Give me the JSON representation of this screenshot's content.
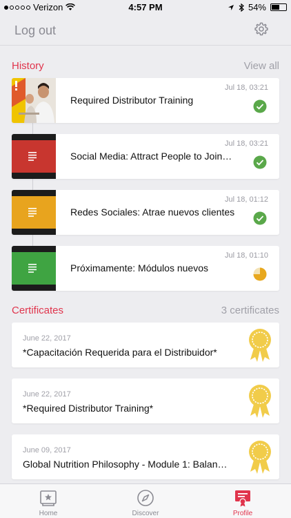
{
  "status_bar": {
    "carrier": "Verizon",
    "time": "4:57 PM",
    "battery": "54%",
    "battery_level": 0.54,
    "signal_dots_filled": 1,
    "signal_dots_total": 5
  },
  "header": {
    "logout_label": "Log out",
    "settings_icon": "gear-icon"
  },
  "history": {
    "title": "History",
    "view_all_label": "View all",
    "items": [
      {
        "title": "Required Distributor Training",
        "date": "Jul 18, 03:21",
        "status": "complete",
        "thumb": "photo",
        "thumb_color": "#f0c400"
      },
      {
        "title": "Social Media: Attract People to Join…",
        "date": "Jul 18, 03:21",
        "status": "complete",
        "thumb": "doc",
        "thumb_color": "#c8362f"
      },
      {
        "title": "Redes Sociales: Atrae nuevos clientes",
        "date": "Jul 18, 01:12",
        "status": "complete",
        "thumb": "doc",
        "thumb_color": "#e8a41e"
      },
      {
        "title": "Próximamente: Módulos nuevos",
        "date": "Jul 18, 01:10",
        "status": "in-progress",
        "thumb": "doc",
        "thumb_color": "#3fa442"
      }
    ]
  },
  "certificates": {
    "title": "Certificates",
    "count_label": "3 certificates",
    "items": [
      {
        "date": "June 22, 2017",
        "title": "*Capacitación Requerida para el Distribuidor*"
      },
      {
        "date": "June 22, 2017",
        "title": "*Required Distributor Training*"
      },
      {
        "date": "June 09, 2017",
        "title": "Global Nutrition Philosophy - Module 1: Balan…"
      }
    ]
  },
  "tabbar": {
    "tabs": [
      {
        "label": "Home",
        "icon": "star-card-icon",
        "active": false
      },
      {
        "label": "Discover",
        "icon": "compass-icon",
        "active": false
      },
      {
        "label": "Profile",
        "icon": "certificate-icon",
        "active": true
      }
    ]
  },
  "colors": {
    "accent": "#e0344c",
    "complete": "#5aa84a",
    "in_progress": "#e8a81e",
    "ribbon_gold": "#f1cc4a"
  }
}
